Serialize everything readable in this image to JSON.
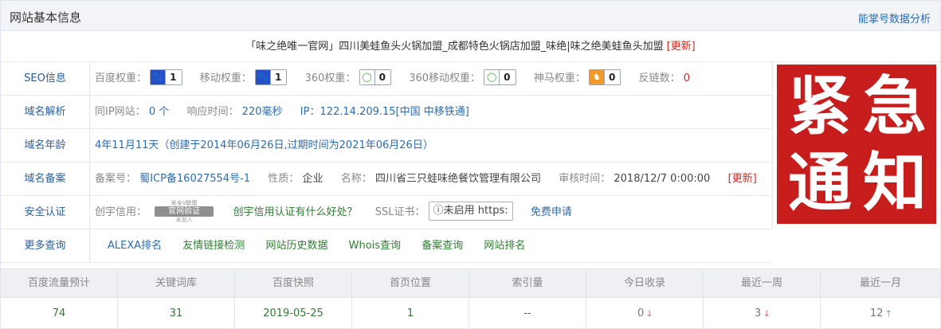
{
  "header": {
    "title": "网站基本信息",
    "link": "能掌号数据分析"
  },
  "site_title": {
    "text": "「味之绝唯一官网」四川美蛙鱼头火锅加盟_成都特色火锅店加盟_味绝|味之绝美蛙鱼头加盟",
    "update": "[更新]"
  },
  "rows": {
    "seo": {
      "label": "SEO信息",
      "baidu_label": "百度权重：",
      "baidu_value": "1",
      "mobile_label": "移动权重：",
      "mobile_value": "1",
      "so_label": "360权重：",
      "so_value": "0",
      "so_mobile_label": "360移动权重：",
      "so_mobile_value": "0",
      "shenma_label": "神马权重：",
      "shenma_value": "0",
      "backlinks_label": "反链数：",
      "backlinks_value": "0"
    },
    "dns": {
      "label": "域名解析",
      "same_ip_label": "同IP网站：",
      "same_ip_value": "0 个",
      "response_label": "响应时间：",
      "response_value": "220毫秒",
      "ip_text": "IP：122.14.209.15[中国 中移铁通]"
    },
    "age": {
      "label": "域名年龄",
      "text": "4年11月11天（创建于2014年06月26日,过期时间为2021年06月26日）"
    },
    "icp": {
      "label": "域名备案",
      "no_label": "备案号：",
      "no_value": "蜀ICP备16027554号-1",
      "type_label": "性质：",
      "type_value": "企业",
      "name_label": "名称：",
      "name_value": "四川省三只蛙味绝餐饮管理有限公司",
      "time_label": "审核时间：",
      "time_value": "2018/12/7 0:00:00",
      "update": "[更新]"
    },
    "security": {
      "label": "安全认证",
      "credit_label": "创宇信用：",
      "seal_top": "安全V联盟",
      "seal_main": "官网验证",
      "seal_bottom": "未加入",
      "credit_link": "创宇信用认证有什么好处？",
      "ssl_label": "SSL证书：",
      "ssl_value": "ⓘ未启用 https:",
      "ssl_link": "免费申请"
    },
    "more": {
      "label": "更多查询",
      "links": [
        "ALEXA排名",
        "友情链接检测",
        "网站历史数据",
        "Whois查询",
        "备案查询",
        "网站排名"
      ]
    }
  },
  "notice": {
    "chars": [
      "紧",
      "急",
      "通",
      "知"
    ],
    "color": "#c81d1d"
  },
  "stats": {
    "headers": [
      "百度流量预计",
      "关键词库",
      "百度快照",
      "首页位置",
      "索引量",
      "今日收录",
      "最近一周",
      "最近一月"
    ],
    "values": [
      "74",
      "31",
      "2019-05-25",
      "1",
      "--",
      "0",
      "3",
      "12"
    ],
    "trends": [
      "",
      "",
      "",
      "",
      "",
      "down",
      "down",
      "up"
    ]
  }
}
